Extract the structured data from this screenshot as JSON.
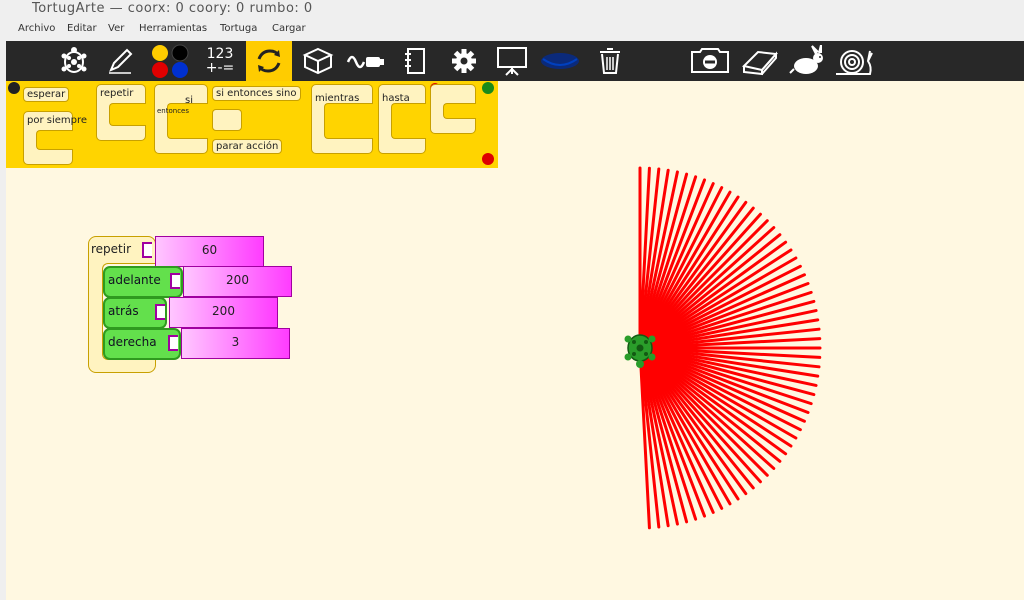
{
  "window": {
    "title": "TortugArte — coorx: 0 coory: 0 rumbo: 0"
  },
  "menu": [
    "Archivo",
    "Editar",
    "Ver",
    "Herramientas",
    "Tortuga",
    "Cargar"
  ],
  "toolbar": {
    "numbers_top": "123",
    "numbers_bottom": "+-=",
    "icons": [
      "turtle-icon",
      "pen-icon",
      "colors-icon",
      "numbers-icon",
      "flow-icon",
      "blocks-icon",
      "sensors-icon",
      "notebook-icon",
      "gear-icon",
      "presentation-icon",
      "portfolio-icon",
      "trash-icon",
      "stop-icon",
      "eraser-icon",
      "rabbit-icon",
      "snail-icon"
    ]
  },
  "palette": {
    "blocks": {
      "esperar": "esperar",
      "por_siempre": "por siempre",
      "repetir": "repetir",
      "si": "si",
      "entonces": "entonces",
      "si_entonces_sino": "si entonces sino",
      "parar_accion": "parar acción",
      "mientras": "mientras",
      "hasta": "hasta"
    }
  },
  "program": {
    "repeat_label": "repetir",
    "repeat_value": "60",
    "forward_label": "adelante",
    "forward_value": "200",
    "back_label": "atrás",
    "back_value": "200",
    "right_label": "derecha",
    "right_value": "3"
  },
  "colors": {
    "accent": "#ffd400",
    "pen": "#ff0000",
    "turtle": "#2a9d2a",
    "canvas": "#fff8e1"
  }
}
